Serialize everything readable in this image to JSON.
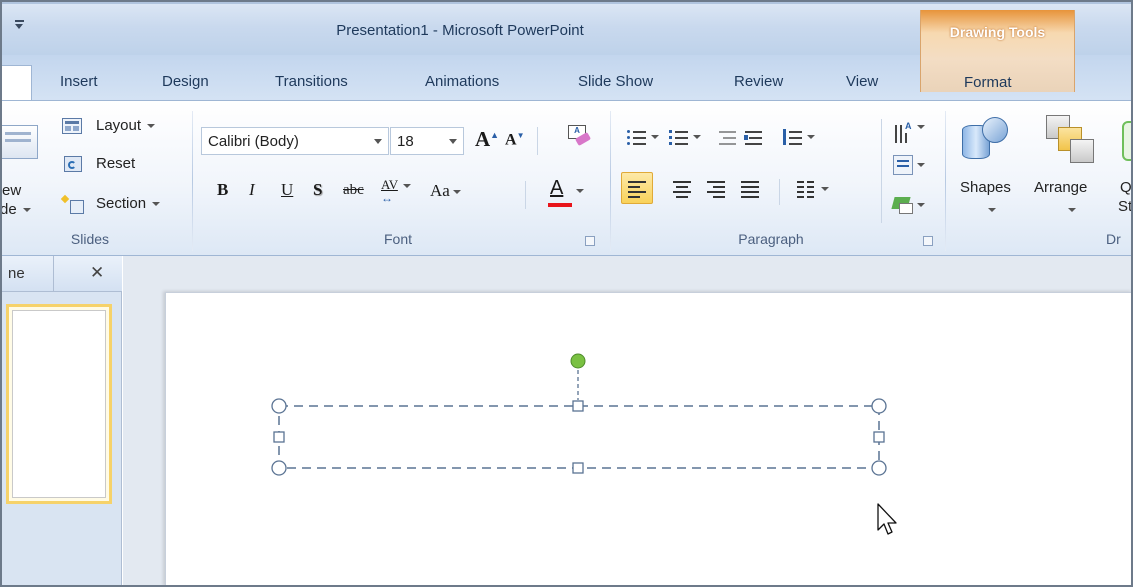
{
  "window": {
    "title": "Presentation1  -  Microsoft PowerPoint",
    "contextual_tab_group": "Drawing Tools"
  },
  "tabs": [
    "Insert",
    "Design",
    "Transitions",
    "Animations",
    "Slide Show",
    "Review",
    "View",
    "Format"
  ],
  "ribbon": {
    "slides": {
      "new_slide_label_1": "ew",
      "new_slide_label_2": "de",
      "layout": "Layout",
      "reset": "Reset",
      "section": "Section",
      "group_label": "Slides"
    },
    "font": {
      "font_name": "Calibri (Body)",
      "font_size": "18",
      "grow": "A",
      "shrink": "A",
      "bold": "B",
      "italic": "I",
      "underline": "U",
      "shadow": "S",
      "strikethrough": "abc",
      "spacing": "AV",
      "change_case": "Aa",
      "font_color": "A",
      "group_label": "Font"
    },
    "paragraph": {
      "group_label": "Paragraph"
    },
    "drawing": {
      "shapes": "Shapes",
      "arrange": "Arrange",
      "quick_styles_1": "Q",
      "quick_styles_2": "St",
      "group_label": "Dr"
    }
  },
  "left_panel": {
    "tab_label": "ne",
    "close": "✕"
  },
  "colors": {
    "accent_blue": "#1e395b",
    "drawing_tools_orange": "#e7943a",
    "rotate_handle": "#7ac142",
    "selection_dash": "#5a7393",
    "font_color_bar": "#e8151b"
  }
}
